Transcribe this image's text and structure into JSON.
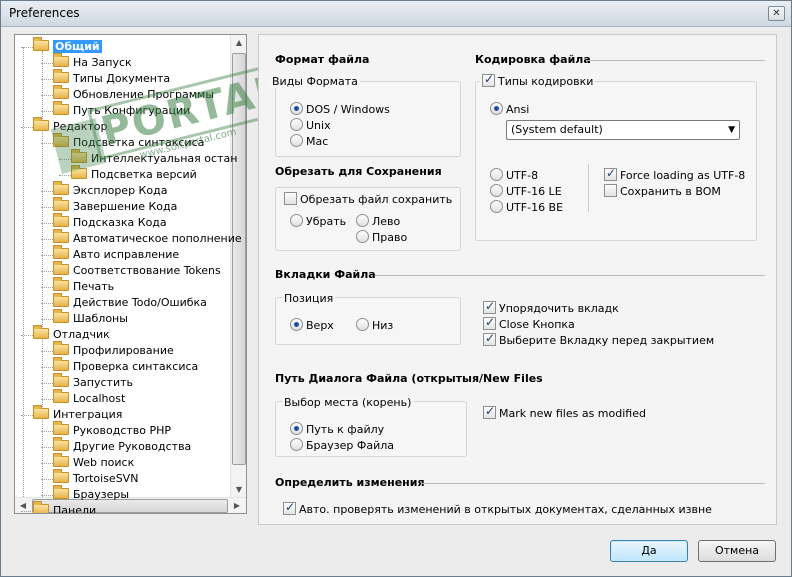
{
  "window": {
    "title": "Preferences",
    "close_glyph": "✕"
  },
  "tree": {
    "items": [
      {
        "label": "Общий",
        "level": 0,
        "selected": true
      },
      {
        "label": "На Запуск",
        "level": 1
      },
      {
        "label": "Типы Документа",
        "level": 1
      },
      {
        "label": "Обновление Программы",
        "level": 1
      },
      {
        "label": "Путь Конфигурации",
        "level": 1
      },
      {
        "label": "Редактор",
        "level": 0
      },
      {
        "label": "Подсветка синтаксиса",
        "level": 1
      },
      {
        "label": "Интеллектуальная остан",
        "level": 2
      },
      {
        "label": "Подсветка версий",
        "level": 2
      },
      {
        "label": "Эксплорер Кода",
        "level": 1
      },
      {
        "label": "Завершение Кода",
        "level": 1
      },
      {
        "label": "Подсказка Кода",
        "level": 1
      },
      {
        "label": "Автоматическое пополнение",
        "level": 1
      },
      {
        "label": "Авто исправление",
        "level": 1
      },
      {
        "label": "Соответствование Tokens",
        "level": 1
      },
      {
        "label": "Печать",
        "level": 1
      },
      {
        "label": "Действие Todo/Ошибка",
        "level": 1
      },
      {
        "label": "Шаблоны",
        "level": 1
      },
      {
        "label": "Отладчик",
        "level": 0
      },
      {
        "label": "Профилирование",
        "level": 1
      },
      {
        "label": "Проверка синтаксиса",
        "level": 1
      },
      {
        "label": "Запустить",
        "level": 1
      },
      {
        "label": "Localhost",
        "level": 1
      },
      {
        "label": "Интеграция",
        "level": 0
      },
      {
        "label": "Руководство PHP",
        "level": 1
      },
      {
        "label": "Другие Руководства",
        "level": 1
      },
      {
        "label": "Web поиск",
        "level": 1
      },
      {
        "label": "TortoiseSVN",
        "level": 1
      },
      {
        "label": "Браузеры",
        "level": 1
      },
      {
        "label": "Панели",
        "level": 0
      }
    ]
  },
  "watermark": {
    "brand": "PORTAL",
    "url": "www.softportal.com"
  },
  "file_format": {
    "heading": "Формат файла",
    "group_title": "Виды Формата",
    "options": [
      "DOS / Windows",
      "Unix",
      "Mac"
    ],
    "selected": "DOS / Windows"
  },
  "trim": {
    "heading": "Обрезать для Сохранения",
    "checkbox": "Обрезать файл сохранить",
    "checked": false,
    "options": [
      "Убрать",
      "Лево",
      "Право"
    ]
  },
  "encoding": {
    "heading": "Кодировка файла",
    "types_label": "Типы кодировки",
    "types_checked": true,
    "ansi_label": "Ansi",
    "ansi_checked": true,
    "select_value": "(System default)",
    "unicode_options": [
      "UTF-8",
      "UTF-16 LE",
      "UTF-16 BE"
    ],
    "force_utf8": "Force loading as UTF-8",
    "force_utf8_checked": true,
    "save_bom": "Сохранить в BOM",
    "save_bom_checked": false
  },
  "tabs": {
    "heading": "Вкладки Файла",
    "position_title": "Позиция",
    "position_options": [
      "Верх",
      "Низ"
    ],
    "position_selected": "Верх",
    "checks": [
      {
        "label": "Упорядочить вкладк",
        "checked": true
      },
      {
        "label": "Close Кнопка",
        "checked": true
      },
      {
        "label": "Выберите Вкладку перед закрытием",
        "checked": true
      }
    ]
  },
  "dialog_path": {
    "heading": "Путь Диалога Файла (открытыя/",
    "group_title": "Выбор места (корень)",
    "options": [
      "Путь к файлу",
      "Браузер Файла"
    ],
    "selected": "Путь к файлу"
  },
  "new_files": {
    "heading": "New Files",
    "mark_label": "Mark new files as modified",
    "mark_checked": true
  },
  "detect_changes": {
    "heading": "Определить изменения",
    "auto_label": "Авто. проверять изменений в открытых документах, сделанных извне",
    "auto_checked": true
  },
  "buttons": {
    "ok": "Да",
    "cancel": "Отмена"
  }
}
